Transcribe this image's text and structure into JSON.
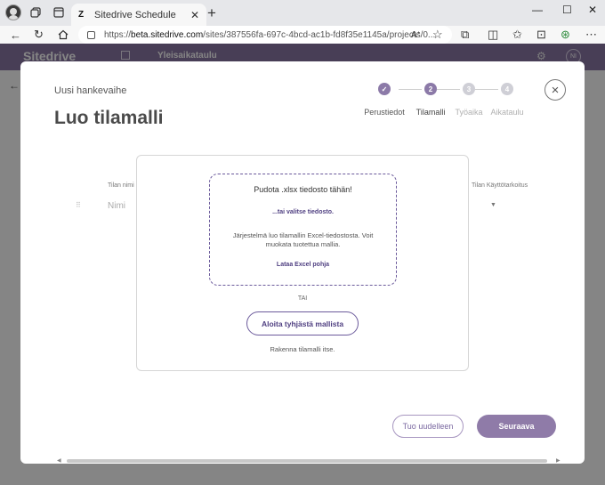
{
  "browser": {
    "tab_title": "Sitedrive Schedule",
    "tab_favicon": "Z",
    "url_prefix": "https://",
    "url_domain": "beta.sitedrive.com",
    "url_path": "/sites/387556fa-697c-4bcd-ac1b-fd8f35e1145a/projects/0..."
  },
  "app": {
    "logo": "Sitedrive",
    "breadcrumb": "Yleisaikataulu",
    "user_initials": "NI"
  },
  "modal": {
    "subtitle": "Uusi hankevaihe",
    "title": "Luo tilamalli",
    "close_label": "×",
    "steps": [
      {
        "number": "✓",
        "label": "Perustiedot",
        "state": "done"
      },
      {
        "number": "2",
        "label": "Tilamalli",
        "state": "active"
      },
      {
        "number": "3",
        "label": "Työaika",
        "state": "inactive"
      },
      {
        "number": "4",
        "label": "Aikataulu",
        "state": "inactive"
      }
    ],
    "background_fields": {
      "name_label": "Tilan nimi",
      "name_placeholder": "Nimi",
      "purpose_label": "Tilan Käyttötarkoitus"
    },
    "upload": {
      "dropzone_title": "Pudota .xlsx tiedosto tähän!",
      "select_file_link": "...tai valitse tiedosto.",
      "description": "Järjestelmä luo tilamallin Excel-tiedostosta. Voit muokata tuotettua mallia.",
      "template_link": "Lataa Excel pohja",
      "separator": "TAI",
      "empty_button": "Aloita tyhjästä mallista",
      "empty_description": "Rakenna tilamalli itse."
    },
    "footer": {
      "reimport_button": "Tuo uudelleen",
      "next_button": "Seuraava"
    }
  },
  "colors": {
    "accent": "#6b5a9b",
    "accent_text": "#4f3f81",
    "step_done": "#8c7aa8",
    "step_inactive": "#cfcfd6",
    "header": "#8b78a6"
  }
}
